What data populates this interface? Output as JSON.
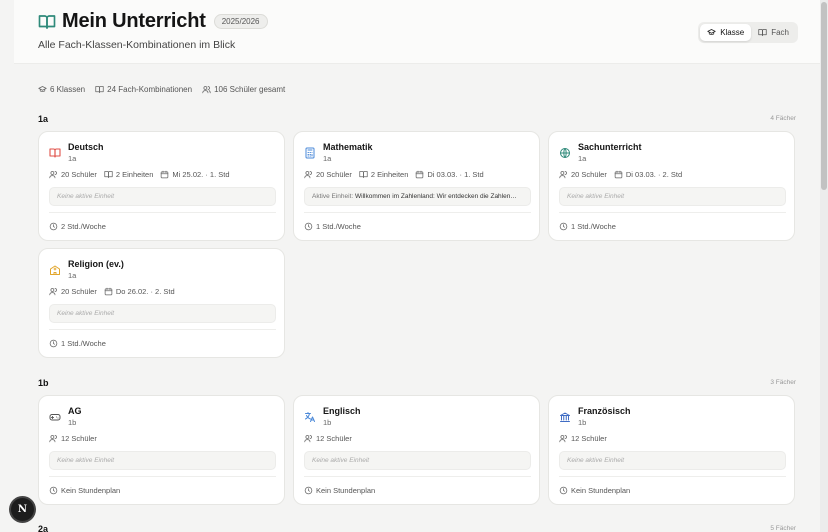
{
  "header": {
    "title": "Mein Unterricht",
    "year": "2025/2026",
    "subtitle": "Alle Fach-Klassen-Kombinationen im Blick",
    "view_toggle": {
      "klasse": "Klasse",
      "fach": "Fach",
      "selected": "Klasse"
    }
  },
  "stats": {
    "classes": "6 Klassen",
    "combinations": "24 Fach-Kombinationen",
    "students": "106 Schüler gesamt"
  },
  "groups": [
    {
      "title": "1a",
      "count": "4 Fächer",
      "cards": [
        {
          "name": "Deutsch",
          "class": "1a",
          "icon": "book-open-icon",
          "icon_color": "#e0524a",
          "students": "20 Schüler",
          "units": "2 Einheiten",
          "next": "Mi 25.02. · 1. Std",
          "unit_text": "Keine aktive Einheit",
          "footer": "2 Std./Woche"
        },
        {
          "name": "Mathematik",
          "class": "1a",
          "icon": "calculator-icon",
          "icon_color": "#4a88d8",
          "students": "20 Schüler",
          "units": "2 Einheiten",
          "next": "Di 03.03. · 1. Std",
          "unit_label": "Aktive Einheit:",
          "unit_text": "Willkommen im Zahlenland: Wir entdecken die Zahlen…",
          "footer": "1 Std./Woche"
        },
        {
          "name": "Sachunterricht",
          "class": "1a",
          "icon": "globe-icon",
          "icon_color": "#2f8a7a",
          "students": "20 Schüler",
          "next": "Di 03.03. · 2. Std",
          "unit_text": "Keine aktive Einheit",
          "footer": "1 Std./Woche"
        },
        {
          "name": "Religion (ev.)",
          "class": "1a",
          "icon": "church-icon",
          "icon_color": "#e2a62c",
          "students": "20 Schüler",
          "next": "Do 26.02. · 2. Std",
          "unit_text": "Keine aktive Einheit",
          "footer": "1 Std./Woche"
        }
      ]
    },
    {
      "title": "1b",
      "count": "3 Fächer",
      "cards": [
        {
          "name": "AG",
          "class": "1b",
          "icon": "gamepad-icon",
          "icon_color": "#555555",
          "students": "12 Schüler",
          "unit_text": "Keine aktive Einheit",
          "footer": "Kein Stundenplan"
        },
        {
          "name": "Englisch",
          "class": "1b",
          "icon": "translate-icon",
          "icon_color": "#4a88d8",
          "students": "12 Schüler",
          "unit_text": "Keine aktive Einheit",
          "footer": "Kein Stundenplan"
        },
        {
          "name": "Französisch",
          "class": "1b",
          "icon": "landmark-icon",
          "icon_color": "#3f6cc4",
          "students": "12 Schüler",
          "unit_text": "Keine aktive Einheit",
          "footer": "Kein Stundenplan"
        }
      ]
    },
    {
      "title": "2a",
      "count": "5 Fächer"
    }
  ],
  "fab": {
    "label": "N"
  }
}
